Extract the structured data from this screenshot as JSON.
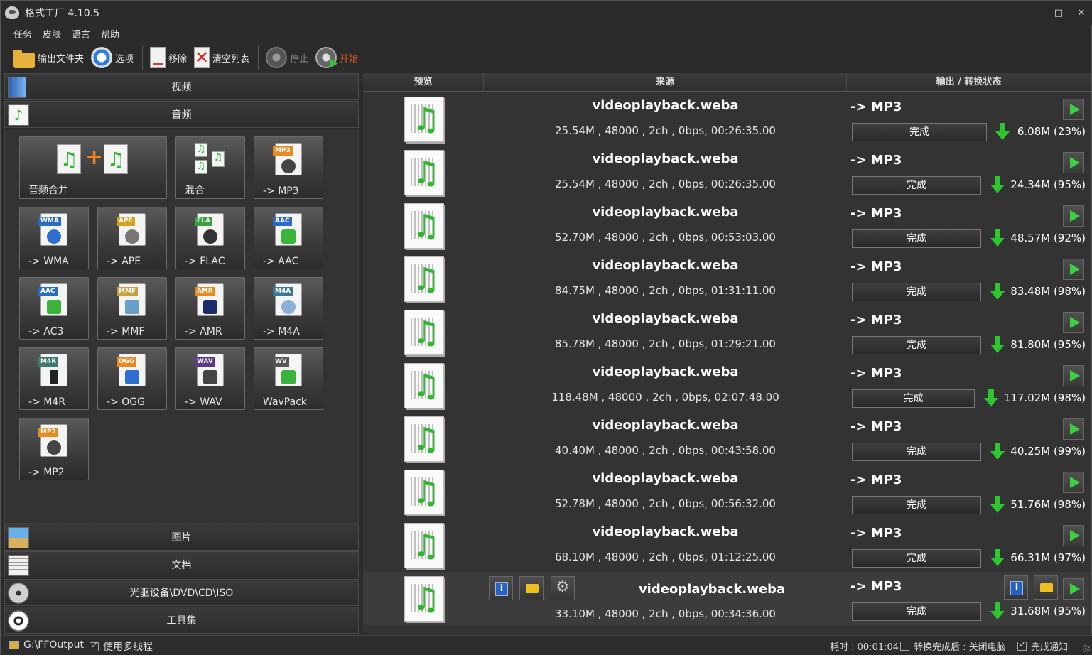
{
  "window": {
    "title": "格式工厂 4.10.5",
    "minimize": "–",
    "maximize": "□",
    "close": "✕"
  },
  "menu": [
    "任务",
    "皮肤",
    "语言",
    "帮助"
  ],
  "toolbar": {
    "output_folder": "输出文件夹",
    "options": "选项",
    "remove": "移除",
    "clear_list": "清空列表",
    "stop": "停止",
    "start": "开始"
  },
  "categories": {
    "video": "视频",
    "audio": "音频",
    "image": "图片",
    "document": "文档",
    "disc": "光驱设备\\DVD\\CD\\ISO",
    "tools": "工具集"
  },
  "audio_tiles": [
    {
      "label": "音频合并",
      "tag": ""
    },
    {
      "label": "混合",
      "tag": ""
    },
    {
      "label": "-> MP3",
      "tag": "MP3"
    },
    {
      "label": "-> WMA",
      "tag": "WMA"
    },
    {
      "label": "-> APE",
      "tag": "APE"
    },
    {
      "label": "-> FLAC",
      "tag": "FLA"
    },
    {
      "label": "-> AAC",
      "tag": "AAC"
    },
    {
      "label": "-> AC3",
      "tag": "AAC"
    },
    {
      "label": "-> MMF",
      "tag": "MMF"
    },
    {
      "label": "-> AMR",
      "tag": "AMR"
    },
    {
      "label": "-> M4A",
      "tag": "M4A"
    },
    {
      "label": "-> M4R",
      "tag": "M4R"
    },
    {
      "label": "-> OGG",
      "tag": "OGG"
    },
    {
      "label": "-> WAV",
      "tag": "WAV"
    },
    {
      "label": "WavPack",
      "tag": "WV"
    },
    {
      "label": "-> MP2",
      "tag": "MP3"
    }
  ],
  "list_headers": {
    "preview": "预览",
    "source": "来源",
    "output": "输出 / 转换状态"
  },
  "tasks": [
    {
      "name": "videoplayback.weba",
      "info": "25.54M , 48000 , 2ch , 0bps, 00:26:35.00",
      "format": "-> MP3",
      "status": "完成",
      "size": "6.08M  (23%)"
    },
    {
      "name": "videoplayback.weba",
      "info": "25.54M , 48000 , 2ch , 0bps, 00:26:35.00",
      "format": "-> MP3",
      "status": "完成",
      "size": "24.34M  (95%)"
    },
    {
      "name": "videoplayback.weba",
      "info": "52.70M , 48000 , 2ch , 0bps, 00:53:03.00",
      "format": "-> MP3",
      "status": "完成",
      "size": "48.57M  (92%)"
    },
    {
      "name": "videoplayback.weba",
      "info": "84.75M , 48000 , 2ch , 0bps, 01:31:11.00",
      "format": "-> MP3",
      "status": "完成",
      "size": "83.48M  (98%)"
    },
    {
      "name": "videoplayback.weba",
      "info": "85.78M , 48000 , 2ch , 0bps, 01:29:21.00",
      "format": "-> MP3",
      "status": "完成",
      "size": "81.80M  (95%)"
    },
    {
      "name": "videoplayback.weba",
      "info": "118.48M , 48000 , 2ch , 0bps, 02:07:48.00",
      "format": "-> MP3",
      "status": "完成",
      "size": "117.02M  (98%)"
    },
    {
      "name": "videoplayback.weba",
      "info": "40.40M , 48000 , 2ch , 0bps, 00:43:58.00",
      "format": "-> MP3",
      "status": "完成",
      "size": "40.25M  (99%)"
    },
    {
      "name": "videoplayback.weba",
      "info": "52.78M , 48000 , 2ch , 0bps, 00:56:32.00",
      "format": "-> MP3",
      "status": "完成",
      "size": "51.76M  (98%)"
    },
    {
      "name": "videoplayback.weba",
      "info": "68.10M , 48000 , 2ch , 0bps, 01:12:25.00",
      "format": "-> MP3",
      "status": "完成",
      "size": "66.31M  (97%)"
    },
    {
      "name": "videoplayback.weba",
      "info": "33.10M , 48000 , 2ch , 0bps, 00:34:36.00",
      "format": "-> MP3",
      "status": "完成",
      "size": "31.68M  (95%)"
    }
  ],
  "statusbar": {
    "output_path": "G:\\FFOutput",
    "multithread": "使用多线程",
    "elapsed": "耗时 : 00:01:04",
    "shutdown": "转换完成后 : 关闭电脑",
    "notify": "完成通知"
  },
  "colors": {
    "start": "#e05a2a",
    "play": "#3cd03c",
    "arrow": "#2ec62e"
  }
}
